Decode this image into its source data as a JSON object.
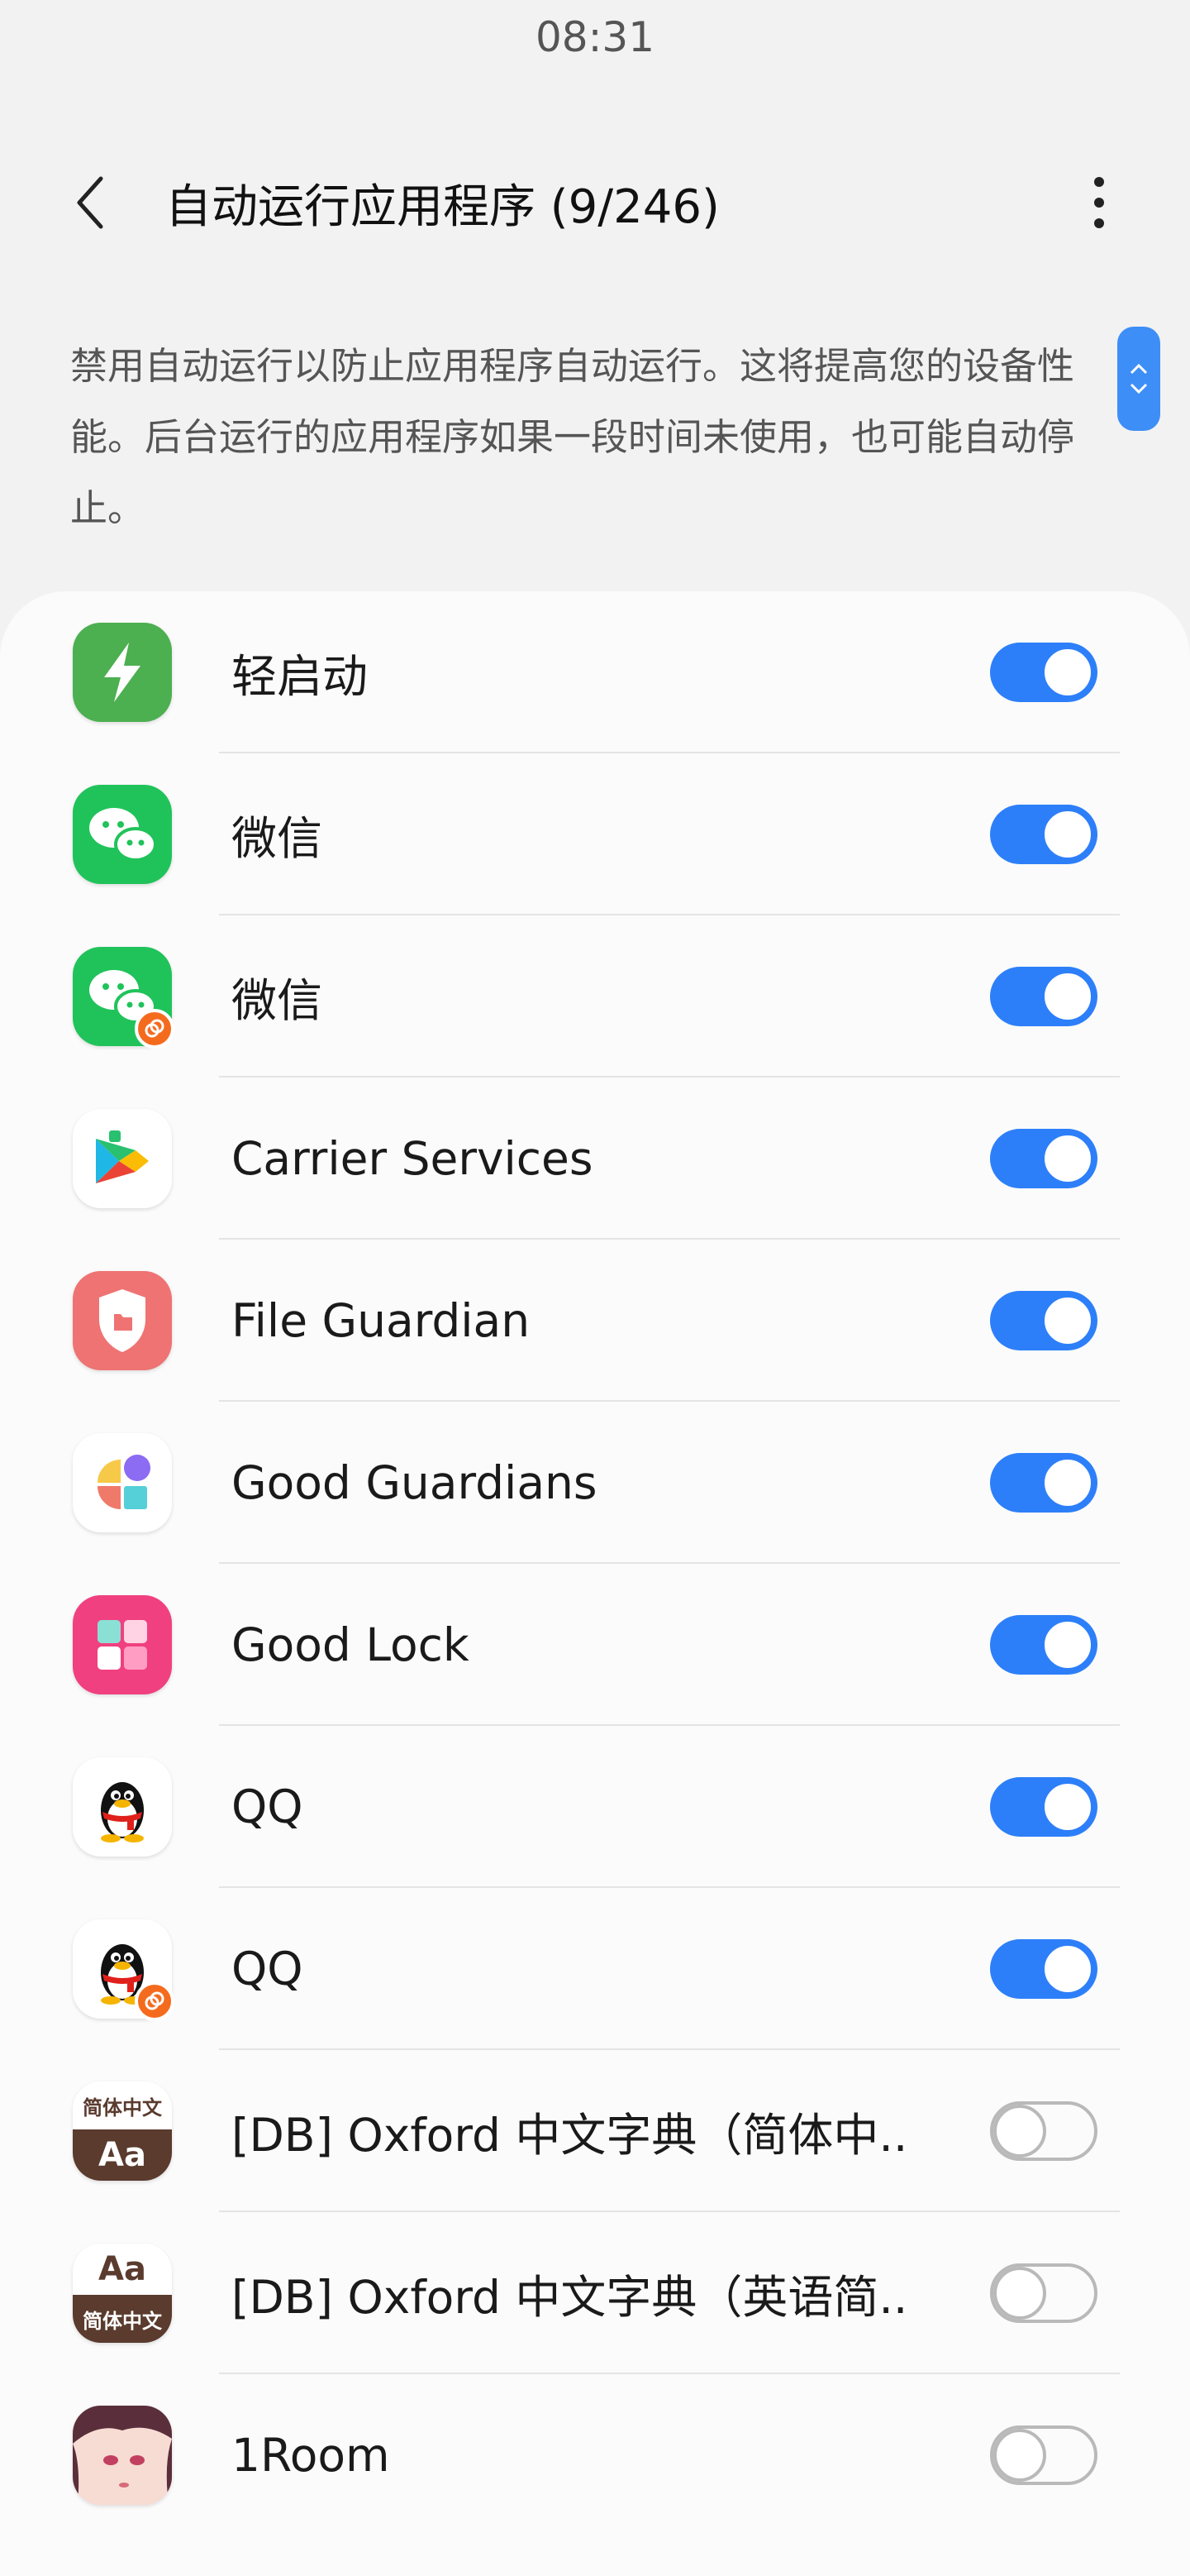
{
  "status": {
    "time": "08:31"
  },
  "header": {
    "title": "自动运行应用程序 (9/246)"
  },
  "description": "禁用自动运行以防止应用程序自动运行。这将提高您的设备性能。后台运行的应用程序如果一段时间未使用，也可能自动停止。",
  "colors": {
    "accent": "#2d7ff9",
    "background": "#f2f2f2",
    "card": "#fbfbfb"
  },
  "apps": [
    {
      "name": "轻启动",
      "icon": "lightning-icon",
      "enabled": true
    },
    {
      "name": "微信",
      "icon": "wechat-icon",
      "enabled": true
    },
    {
      "name": "微信",
      "icon": "wechat-dual-icon",
      "enabled": true
    },
    {
      "name": "Carrier Services",
      "icon": "carrier-services-icon",
      "enabled": true
    },
    {
      "name": "File Guardian",
      "icon": "file-guardian-icon",
      "enabled": true
    },
    {
      "name": "Good Guardians",
      "icon": "good-guardians-icon",
      "enabled": true
    },
    {
      "name": "Good Lock",
      "icon": "good-lock-icon",
      "enabled": true
    },
    {
      "name": "QQ",
      "icon": "qq-icon",
      "enabled": true
    },
    {
      "name": "QQ",
      "icon": "qq-dual-icon",
      "enabled": true
    },
    {
      "name": "[DB] Oxford 中文字典（简体中..",
      "icon": "oxford-dict-zh-icon",
      "enabled": false
    },
    {
      "name": "[DB] Oxford 中文字典（英语简..",
      "icon": "oxford-dict-en-icon",
      "enabled": false
    },
    {
      "name": "1Room",
      "icon": "1room-icon",
      "enabled": false
    }
  ],
  "icon_text": {
    "oxford_zh_top": "简体中文",
    "oxford_zh_bottom": "Aa",
    "oxford_en_top": "Aa",
    "oxford_en_bottom": "简体中文"
  }
}
